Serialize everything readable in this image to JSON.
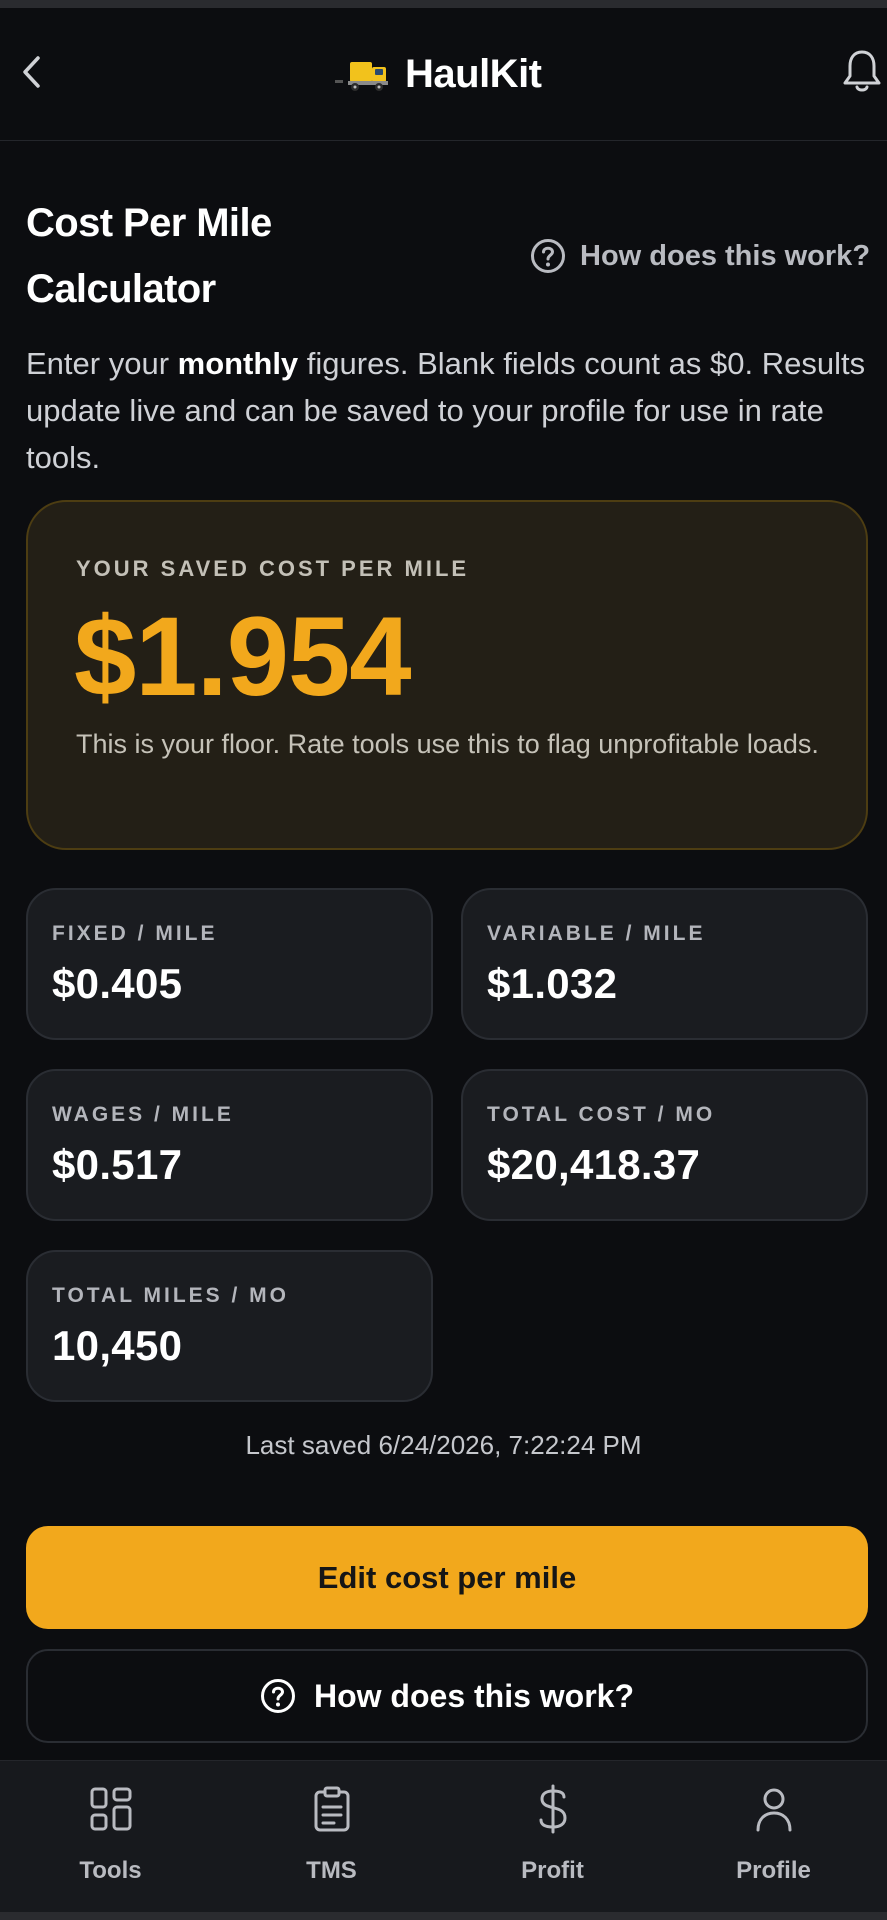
{
  "header": {
    "brand_name": "HaulKit",
    "icons": [
      "chevron-left-icon",
      "truck-logo",
      "bell-icon"
    ]
  },
  "page": {
    "title": "Cost Per Mile Calculator",
    "help_link": "How does this work?",
    "intro_before": "Enter your ",
    "intro_bold": "monthly",
    "intro_after": " figures. Blank fields count as $0. Results update live and can be saved to your profile for use in rate tools."
  },
  "saved": {
    "label": "YOUR SAVED COST PER MILE",
    "value": "$1.954",
    "note": "This is your floor. Rate tools use this to flag unprofitable loads."
  },
  "stats": [
    {
      "label": "FIXED / MILE",
      "value": "$0.405"
    },
    {
      "label": "VARIABLE / MILE",
      "value": "$1.032"
    },
    {
      "label": "WAGES / MILE",
      "value": "$0.517"
    },
    {
      "label": "TOTAL COST / MO",
      "value": "$20,418.37"
    },
    {
      "label": "TOTAL MILES / MO",
      "value": "10,450"
    }
  ],
  "last_saved": "Last saved 6/24/2026, 7:22:24 PM",
  "actions": {
    "edit_label": "Edit cost per mile",
    "help_label": "How does this work?"
  },
  "nav": [
    {
      "label": "Tools",
      "icon": "grid-icon"
    },
    {
      "label": "TMS",
      "icon": "clipboard-icon"
    },
    {
      "label": "Profit",
      "icon": "dollar-icon"
    },
    {
      "label": "Profile",
      "icon": "user-icon"
    }
  ],
  "colors": {
    "accent": "#f2a81c",
    "background": "#0c0d10",
    "card": "#1a1c20",
    "saved_card": "#231f16"
  }
}
